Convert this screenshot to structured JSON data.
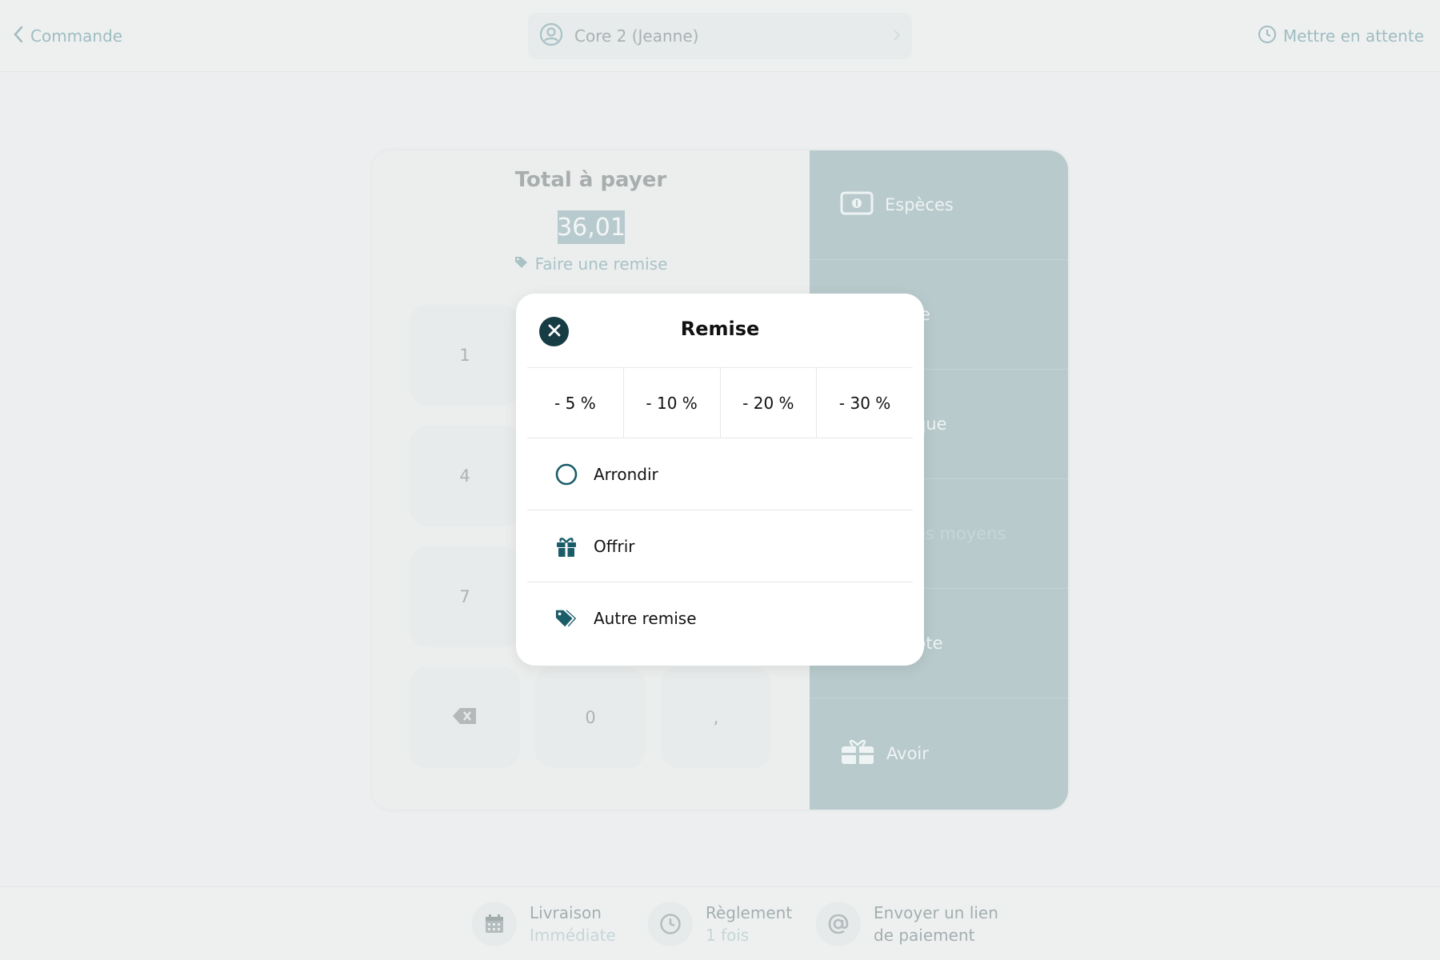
{
  "header": {
    "back_label": "Commande",
    "customer_name": "Core 2 (Jeanne)",
    "hold_label": "Mettre en attente"
  },
  "payment": {
    "total_title": "Total à payer",
    "total_amount": "36,01",
    "discount_link": "Faire une remise",
    "keypad": {
      "k1": "1",
      "k4": "4",
      "k7": "7",
      "k0": "0",
      "kcomma": ","
    },
    "methods": {
      "cash": "Espèces",
      "m2": "e",
      "m3": "que",
      "m4": "es moyens",
      "m5": "pte",
      "credit": "Avoir"
    }
  },
  "footer": {
    "delivery_label": "Livraison",
    "delivery_value": "Immédiate",
    "settlement_label": "Règlement",
    "settlement_value": "1 fois",
    "link_line1": "Envoyer un lien",
    "link_line2": "de paiement"
  },
  "modal": {
    "title": "Remise",
    "percentages": [
      "- 5 %",
      "- 10 %",
      "- 20 %",
      "- 30 %"
    ],
    "round_label": "Arrondir",
    "offer_label": "Offrir",
    "other_label": "Autre remise"
  },
  "colors": {
    "accent": "#1a5c68",
    "dark": "#163c44",
    "panel": "#b8cacc"
  }
}
